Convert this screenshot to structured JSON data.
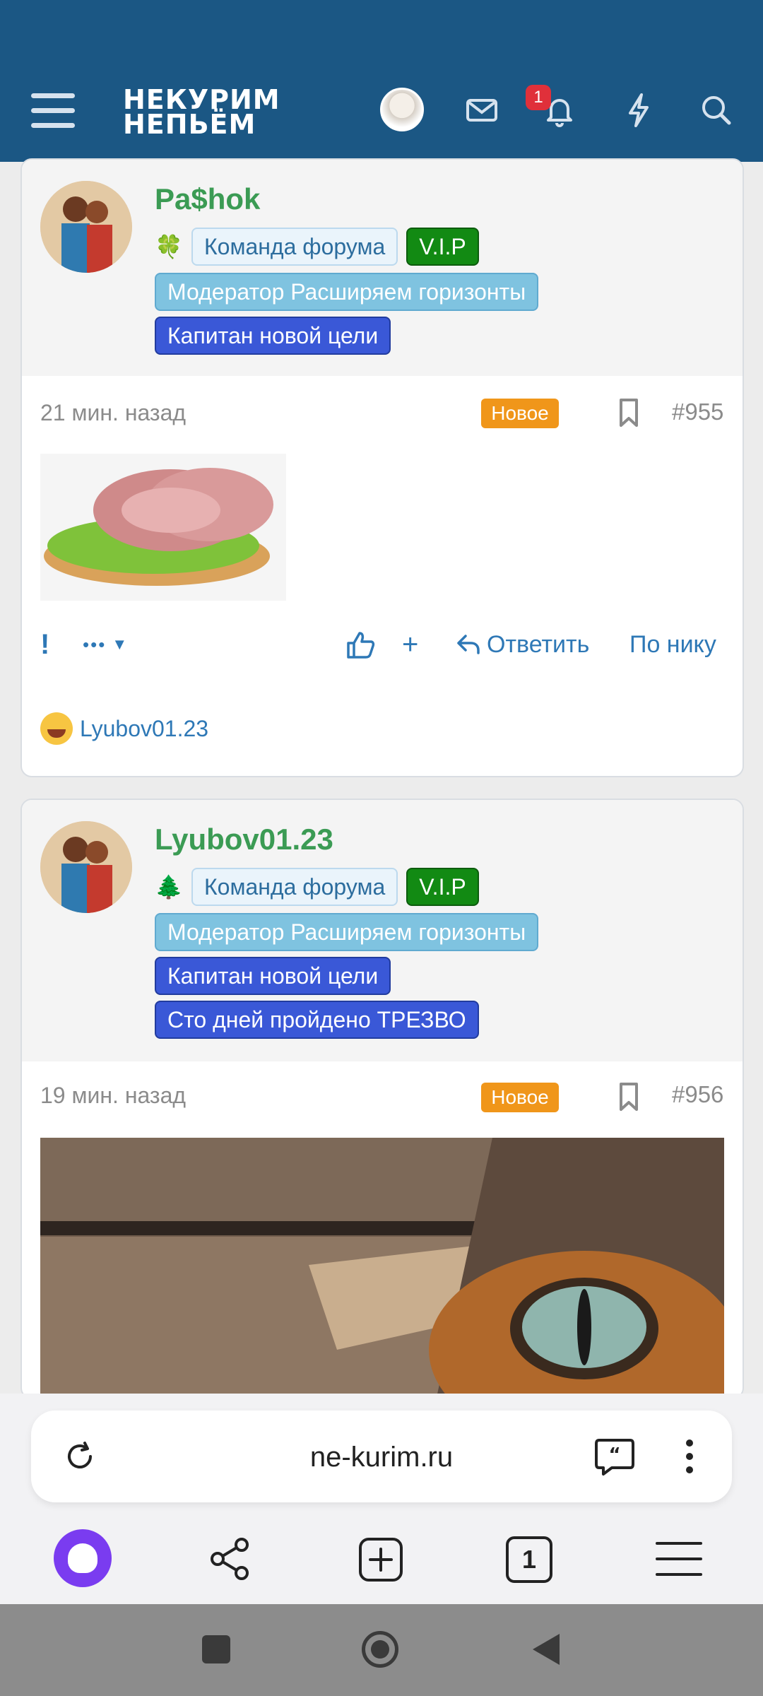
{
  "header": {
    "logo_line1": "НЕКУРИМ",
    "logo_line2": "НЕПЬЁМ",
    "notification_count": "1",
    "accent_color": "#1b5784"
  },
  "posts": [
    {
      "username": "Pa$hok",
      "emoji": "🍀",
      "tags": [
        "Команда форума",
        "V.I.P",
        "Модератор Расширяем горизонты",
        "Капитан новой цели"
      ],
      "time": "21 мин. назад",
      "status": "Новое",
      "number": "#955",
      "image_alt": "sandwich-image",
      "actions": {
        "report": "!",
        "more": "•••",
        "reply": "Ответить",
        "by_nick": "По нику"
      },
      "reactor": "Lyubov01.23"
    },
    {
      "username": "Lyubov01.23",
      "emoji": "🌲",
      "tags": [
        "Команда форума",
        "V.I.P",
        "Модератор Расширяем горизонты",
        "Капитан новой цели",
        "Сто дней пройдено ТРЕЗВО"
      ],
      "time": "19 мин. назад",
      "status": "Новое",
      "number": "#956",
      "image_alt": "cat-eye-image"
    }
  ],
  "browser": {
    "url": "ne-kurim.ru",
    "tab_count": "1"
  }
}
